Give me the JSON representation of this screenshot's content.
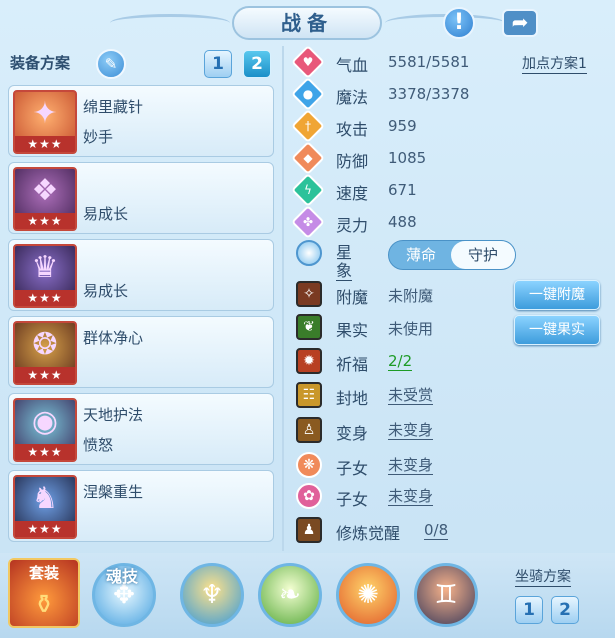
{
  "header": {
    "title": "战备",
    "info_icon": "exclamation-icon",
    "share_icon": "share-icon"
  },
  "equip": {
    "heading": "装备方案",
    "plan_buttons": [
      "1",
      "2"
    ],
    "items": [
      {
        "name": "绵里藏针",
        "sub": "妙手",
        "stars": "★★★"
      },
      {
        "name": "",
        "sub": "易成长",
        "stars": "★★★"
      },
      {
        "name": "",
        "sub": "易成长",
        "stars": "★★★"
      },
      {
        "name": "群体净心",
        "sub": "",
        "stars": "★★★"
      },
      {
        "name": "天地护法",
        "sub": "愤怒",
        "stars": "★★★"
      },
      {
        "name": "涅槃重生",
        "sub": "",
        "stars": "★★★"
      }
    ]
  },
  "stats": {
    "plan_link": "加点方案1",
    "rows": [
      {
        "label": "气血",
        "value": "5581/5581",
        "color": "#e8587a",
        "icon": "heart-icon"
      },
      {
        "label": "魔法",
        "value": "3378/3378",
        "color": "#3fa4e8",
        "icon": "mana-icon"
      },
      {
        "label": "攻击",
        "value": "959",
        "color": "#f0a534",
        "icon": "sword-icon"
      },
      {
        "label": "防御",
        "value": "1085",
        "color": "#f08a5a",
        "icon": "shield-icon"
      },
      {
        "label": "速度",
        "value": "671",
        "color": "#2cc29a",
        "icon": "lightning-icon"
      },
      {
        "label": "灵力",
        "value": "488",
        "color": "#c58ce6",
        "icon": "spirit-icon"
      }
    ]
  },
  "star_sign": {
    "label": "星象",
    "options": [
      "薄命",
      "守护"
    ],
    "selected": "守护"
  },
  "features": [
    {
      "label": "附魔",
      "value": "未附魔",
      "color": "#7a3a22",
      "icon": "enchant-icon",
      "style": "plain"
    },
    {
      "label": "果实",
      "value": "未使用",
      "color": "#3a7d2a",
      "icon": "fruit-icon",
      "style": "plain"
    },
    {
      "label": "祈福",
      "value": "2/2",
      "color": "#b84022",
      "icon": "bless-icon",
      "style": "green"
    },
    {
      "label": "封地",
      "value": "未受赏",
      "color": "#c9972a",
      "icon": "fief-icon",
      "style": "link"
    },
    {
      "label": "变身",
      "value": "未变身",
      "color": "#8a5a20",
      "icon": "transform-icon",
      "style": "link"
    },
    {
      "label": "子女",
      "value": "未变身",
      "color": "#f08a5a",
      "icon": "child-icon",
      "style": "link"
    },
    {
      "label": "子女",
      "value": "未变身",
      "color": "#e0609a",
      "icon": "lotus-icon",
      "style": "link"
    },
    {
      "label": "修炼觉醒",
      "value": "0/8",
      "color": "#7a4a22",
      "icon": "awaken-icon",
      "style": "link"
    }
  ],
  "actions": {
    "enchant": "一键附魔",
    "fruit": "一键果实"
  },
  "bottom": {
    "suit_label": "套装",
    "soul_label": "魂技",
    "mount_label": "坐骑方案",
    "mount_buttons": [
      "1",
      "2"
    ],
    "orb_icons": [
      "soul-skill-icon",
      "monk-icon",
      "leaf-orb-icon",
      "fire-orb-icon",
      "twins-orb-icon"
    ]
  }
}
